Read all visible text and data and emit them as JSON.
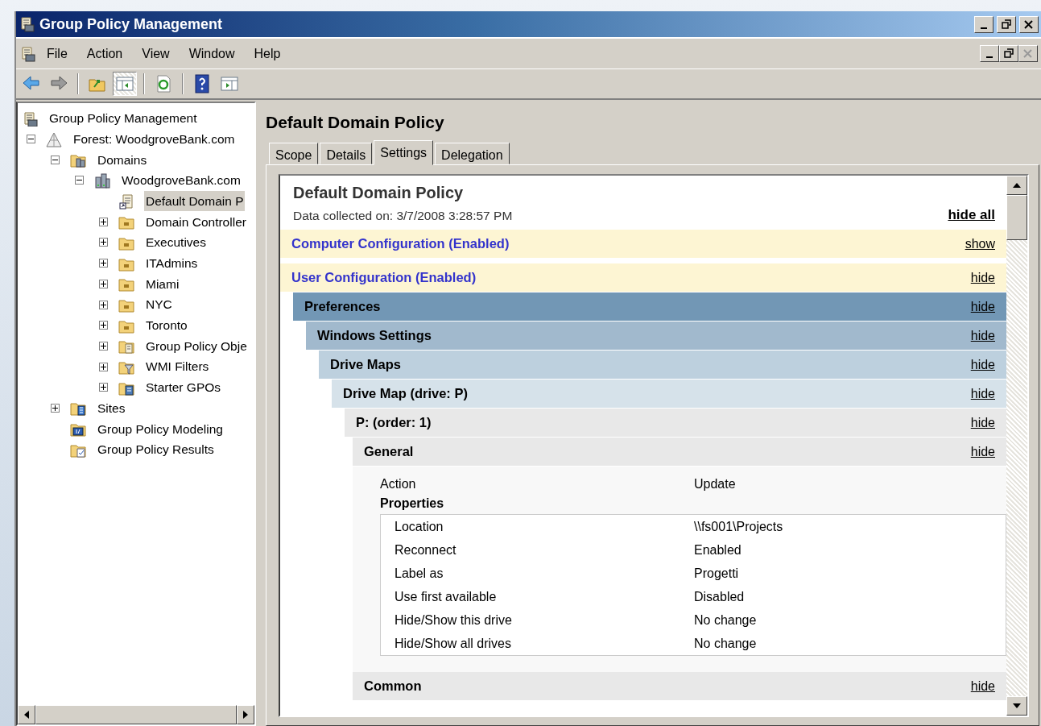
{
  "window": {
    "title": "Group Policy Management"
  },
  "menu": [
    "File",
    "Action",
    "View",
    "Window",
    "Help"
  ],
  "toolbar": [
    {
      "kind": "back",
      "pressed": false
    },
    {
      "kind": "forward",
      "pressed": false
    },
    {
      "kind": "sep"
    },
    {
      "kind": "up",
      "pressed": false
    },
    {
      "kind": "tree-toggle",
      "pressed": true
    },
    {
      "kind": "sep"
    },
    {
      "kind": "refresh",
      "pressed": false
    },
    {
      "kind": "sep"
    },
    {
      "kind": "help",
      "pressed": false
    },
    {
      "kind": "action-pane",
      "pressed": false
    }
  ],
  "tree": [
    {
      "label": "Group Policy Management",
      "kind": "console",
      "selected": false,
      "children": [
        {
          "label": "Forest: WoodgroveBank.com",
          "kind": "forest",
          "expanded": true,
          "selected": false,
          "children": [
            {
              "label": "Domains",
              "kind": "domains",
              "expanded": true,
              "selected": false,
              "children": [
                {
                  "label": "WoodgroveBank.com",
                  "kind": "domain",
                  "expanded": true,
                  "selected": false,
                  "children": [
                    {
                      "label": "Default Domain P",
                      "kind": "gpo-link",
                      "selected": true
                    },
                    {
                      "label": "Domain Controller",
                      "kind": "ou",
                      "expanded": false,
                      "selected": false
                    },
                    {
                      "label": "Executives",
                      "kind": "ou",
                      "expanded": false,
                      "selected": false
                    },
                    {
                      "label": "ITAdmins",
                      "kind": "ou",
                      "expanded": false,
                      "selected": false
                    },
                    {
                      "label": "Miami",
                      "kind": "ou",
                      "expanded": false,
                      "selected": false
                    },
                    {
                      "label": "NYC",
                      "kind": "ou",
                      "expanded": false,
                      "selected": false
                    },
                    {
                      "label": "Toronto",
                      "kind": "ou",
                      "expanded": false,
                      "selected": false
                    },
                    {
                      "label": "Group Policy Obje",
                      "kind": "gpo-folder",
                      "expanded": false,
                      "selected": false
                    },
                    {
                      "label": "WMI Filters",
                      "kind": "wmi",
                      "expanded": false,
                      "selected": false
                    },
                    {
                      "label": "Starter GPOs",
                      "kind": "starter",
                      "expanded": false,
                      "selected": false
                    }
                  ]
                }
              ]
            },
            {
              "label": "Sites",
              "kind": "sites",
              "expanded": false,
              "selected": false
            },
            {
              "label": "Group Policy Modeling",
              "kind": "modeling",
              "selected": false
            },
            {
              "label": "Group Policy Results",
              "kind": "results",
              "selected": false
            }
          ]
        }
      ]
    }
  ],
  "details": {
    "title": "Default Domain Policy",
    "tabs": [
      {
        "label": "Scope",
        "selected": false
      },
      {
        "label": "Details",
        "selected": false
      },
      {
        "label": "Settings",
        "selected": true
      },
      {
        "label": "Delegation",
        "selected": false
      }
    ],
    "report": {
      "title": "Default Domain Policy",
      "collected": "Data collected on: 3/7/2008 3:28:57 PM",
      "hide_all": "hide all",
      "sections": [
        {
          "title": "Computer Configuration (Enabled)",
          "toggle": "show"
        },
        {
          "title": "User Configuration (Enabled)",
          "toggle": "hide",
          "children": [
            {
              "title": "Preferences",
              "toggle": "hide",
              "children": [
                {
                  "title": "Windows Settings",
                  "toggle": "hide",
                  "children": [
                    {
                      "title": "Drive Maps",
                      "toggle": "hide",
                      "children": [
                        {
                          "title": "Drive Map (drive: P)",
                          "toggle": "hide",
                          "children": [
                            {
                              "title": "P: (order: 1)",
                              "toggle": "hide",
                              "children": [
                                {
                                  "title": "General",
                                  "toggle": "hide",
                                  "content": {
                                    "rows": [
                                      {
                                        "name": "Action",
                                        "value": "Update"
                                      }
                                    ],
                                    "group": {
                                      "title": "Properties",
                                      "rows": [
                                        {
                                          "name": "Location",
                                          "value": "\\\\fs001\\Projects"
                                        },
                                        {
                                          "name": "Reconnect",
                                          "value": "Enabled"
                                        },
                                        {
                                          "name": "Label as",
                                          "value": "Progetti"
                                        },
                                        {
                                          "name": "Use first available",
                                          "value": "Disabled"
                                        },
                                        {
                                          "name": "Hide/Show this drive",
                                          "value": "No change"
                                        },
                                        {
                                          "name": "Hide/Show all drives",
                                          "value": "No change"
                                        }
                                      ]
                                    }
                                  }
                                },
                                {
                                  "title": "Common",
                                  "toggle": "hide"
                                }
                              ]
                            }
                          ]
                        }
                      ]
                    }
                  ]
                }
              ]
            }
          ]
        }
      ]
    }
  }
}
